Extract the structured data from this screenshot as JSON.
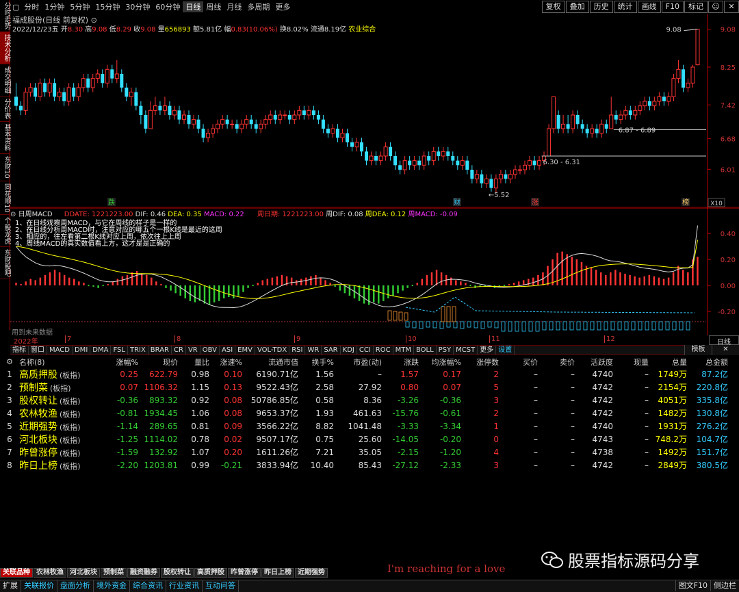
{
  "left_tabs": [
    "分时走势",
    "技术分析",
    "成交明细",
    "分价表",
    "基本资料",
    "东财10",
    "同花顺10",
    "个股龙虎",
    "东财股吧"
  ],
  "left_tab_active": 1,
  "periods": [
    "分时",
    "1分钟",
    "5分钟",
    "15分钟",
    "30分钟",
    "60分钟",
    "日线",
    "周线",
    "月线",
    "多周期",
    "更多"
  ],
  "period_active": 6,
  "right_buttons": [
    "复权",
    "叠加",
    "历史",
    "统计",
    "画线",
    "F10",
    "标记"
  ],
  "stock_title": "福成股份(日线 前复权)",
  "quote": {
    "date": "2022/12/23五",
    "open_label": "开",
    "open": "8.30",
    "high_label": "高",
    "high": "9.08",
    "low_label": "低",
    "low": "8.29",
    "close_label": "收",
    "close": "9.08",
    "vol_label": "量",
    "vol": "656893",
    "amount": "额5.81亿",
    "chg_label": "幅",
    "chg": "0.83(10.06%)",
    "turnover": "换8.02%",
    "float": "流通8.19亿",
    "sector": "农业综合"
  },
  "chart_data": [
    {
      "type": "candlestick",
      "title": "福成股份(日线 前复权)",
      "y_ticks": [
        "9.08",
        "8.25",
        "7.42",
        "6.68",
        "6.01"
      ],
      "ylim": [
        5.4,
        9.3
      ],
      "labels": {
        "hi": "9.08",
        "lo": "5.52",
        "zone1": "6.87 - 6.89",
        "zone2": "6.30 - 6.31"
      },
      "signals": [
        "跌",
        "财",
        "涨",
        "榜"
      ],
      "x10": "X10",
      "date_ticks": [
        "2022年",
        "7",
        "8",
        "9",
        "10",
        "11",
        "12"
      ],
      "ohlc": [
        [
          7.6,
          7.4,
          7.9,
          7.3
        ],
        [
          7.4,
          7.3,
          7.5,
          7.2
        ],
        [
          7.3,
          7.7,
          7.8,
          7.2
        ],
        [
          7.7,
          7.8,
          7.9,
          7.6
        ],
        [
          7.8,
          7.6,
          7.9,
          7.5
        ],
        [
          7.6,
          7.9,
          8.0,
          7.5
        ],
        [
          7.9,
          7.7,
          8.0,
          7.6
        ],
        [
          7.7,
          7.9,
          8.0,
          7.6
        ],
        [
          7.9,
          7.6,
          8.0,
          7.5
        ],
        [
          7.6,
          7.7,
          7.8,
          7.5
        ],
        [
          7.7,
          7.5,
          7.8,
          7.4
        ],
        [
          7.5,
          7.8,
          7.9,
          7.4
        ],
        [
          7.8,
          7.6,
          7.9,
          7.5
        ],
        [
          7.6,
          7.8,
          7.9,
          7.5
        ],
        [
          7.8,
          8.0,
          8.1,
          7.7
        ],
        [
          8.0,
          7.8,
          8.1,
          7.7
        ],
        [
          7.8,
          8.0,
          8.1,
          7.7
        ],
        [
          8.0,
          8.1,
          8.2,
          7.9
        ],
        [
          8.1,
          7.9,
          8.2,
          7.8
        ],
        [
          7.9,
          8.2,
          8.3,
          7.8
        ],
        [
          8.2,
          8.0,
          8.3,
          7.9
        ],
        [
          8.0,
          8.1,
          8.4,
          7.9
        ],
        [
          8.1,
          7.8,
          8.2,
          7.7
        ],
        [
          7.8,
          7.6,
          7.9,
          7.5
        ],
        [
          7.6,
          7.7,
          7.8,
          7.4
        ],
        [
          7.7,
          7.4,
          7.8,
          7.3
        ],
        [
          7.4,
          7.2,
          7.5,
          7.0
        ],
        [
          7.2,
          6.9,
          7.3,
          6.8
        ],
        [
          6.9,
          7.3,
          7.5,
          6.9
        ],
        [
          7.3,
          7.4,
          7.6,
          7.2
        ],
        [
          7.4,
          7.3,
          7.5,
          7.2
        ],
        [
          7.3,
          7.4,
          7.6,
          7.2
        ],
        [
          7.4,
          7.2,
          7.5,
          7.1
        ],
        [
          7.2,
          7.3,
          7.4,
          7.1
        ],
        [
          7.3,
          7.1,
          7.4,
          7.0
        ],
        [
          7.1,
          7.2,
          7.3,
          7.0
        ],
        [
          7.2,
          7.0,
          7.3,
          6.9
        ],
        [
          7.0,
          7.1,
          7.2,
          6.9
        ],
        [
          7.1,
          6.9,
          7.2,
          6.8
        ],
        [
          6.9,
          6.7,
          7.0,
          6.6
        ],
        [
          6.7,
          6.8,
          6.9,
          6.6
        ],
        [
          6.8,
          6.9,
          7.0,
          6.7
        ],
        [
          6.9,
          7.0,
          7.1,
          6.8
        ],
        [
          7.0,
          7.1,
          7.2,
          6.9
        ],
        [
          7.1,
          7.0,
          7.2,
          6.9
        ],
        [
          7.0,
          7.0,
          7.1,
          6.9
        ],
        [
          7.0,
          6.9,
          7.1,
          6.8
        ],
        [
          6.9,
          7.0,
          7.1,
          6.8
        ],
        [
          7.0,
          7.1,
          7.2,
          6.9
        ],
        [
          7.1,
          7.0,
          7.2,
          6.9
        ],
        [
          7.0,
          6.9,
          7.1,
          6.8
        ],
        [
          6.9,
          7.0,
          7.1,
          6.8
        ],
        [
          7.0,
          7.1,
          7.2,
          6.9
        ],
        [
          7.1,
          7.2,
          7.3,
          7.0
        ],
        [
          7.2,
          7.1,
          7.3,
          7.0
        ],
        [
          7.1,
          7.2,
          7.3,
          7.0
        ],
        [
          7.2,
          7.2,
          7.3,
          7.1
        ],
        [
          7.2,
          7.1,
          7.3,
          7.0
        ],
        [
          7.1,
          7.2,
          7.3,
          7.0
        ],
        [
          7.2,
          7.3,
          7.4,
          7.1
        ],
        [
          7.3,
          7.2,
          7.4,
          7.1
        ],
        [
          7.2,
          7.3,
          7.4,
          7.1
        ],
        [
          7.3,
          7.2,
          7.4,
          7.1
        ],
        [
          7.2,
          7.1,
          7.3,
          7.0
        ],
        [
          7.1,
          6.9,
          7.2,
          6.8
        ],
        [
          6.9,
          6.8,
          7.0,
          6.7
        ],
        [
          6.8,
          6.9,
          7.0,
          6.7
        ],
        [
          6.9,
          6.7,
          7.0,
          6.6
        ],
        [
          6.7,
          6.8,
          6.9,
          6.6
        ],
        [
          6.8,
          6.6,
          6.9,
          6.5
        ],
        [
          6.6,
          6.5,
          6.7,
          6.4
        ],
        [
          6.5,
          6.6,
          6.7,
          6.4
        ],
        [
          6.6,
          6.4,
          6.7,
          6.3
        ],
        [
          6.4,
          6.2,
          6.5,
          6.1
        ],
        [
          6.2,
          6.3,
          6.4,
          6.1
        ],
        [
          6.3,
          6.2,
          6.4,
          6.1
        ],
        [
          6.2,
          6.3,
          6.4,
          6.1
        ],
        [
          6.3,
          6.5,
          6.6,
          6.2
        ],
        [
          6.5,
          6.3,
          6.6,
          6.2
        ],
        [
          6.3,
          6.1,
          6.4,
          6.0
        ],
        [
          6.1,
          6.0,
          6.2,
          5.9
        ],
        [
          6.0,
          6.2,
          6.3,
          5.9
        ],
        [
          6.2,
          6.1,
          6.3,
          6.0
        ],
        [
          6.1,
          6.2,
          6.3,
          6.0
        ],
        [
          6.2,
          6.1,
          6.3,
          6.0
        ],
        [
          6.1,
          6.3,
          6.4,
          6.0
        ],
        [
          6.3,
          6.2,
          6.4,
          6.1
        ],
        [
          6.2,
          6.4,
          6.5,
          6.1
        ],
        [
          6.4,
          6.3,
          6.5,
          6.2
        ],
        [
          6.3,
          6.4,
          6.5,
          6.2
        ],
        [
          6.4,
          6.3,
          6.5,
          6.2
        ],
        [
          6.3,
          6.2,
          6.4,
          6.1
        ],
        [
          6.2,
          6.1,
          6.3,
          6.0
        ],
        [
          6.1,
          6.2,
          6.3,
          6.0
        ],
        [
          6.2,
          6.0,
          6.3,
          5.9
        ],
        [
          6.0,
          5.8,
          6.1,
          5.7
        ],
        [
          5.8,
          5.9,
          6.0,
          5.7
        ],
        [
          5.9,
          5.7,
          6.0,
          5.6
        ],
        [
          5.7,
          5.8,
          5.9,
          5.6
        ],
        [
          5.8,
          5.6,
          5.9,
          5.52
        ],
        [
          5.6,
          5.8,
          5.9,
          5.5
        ],
        [
          5.8,
          5.9,
          6.0,
          5.7
        ],
        [
          5.9,
          5.8,
          6.0,
          5.7
        ],
        [
          5.8,
          5.9,
          6.0,
          5.7
        ],
        [
          5.9,
          6.0,
          6.1,
          5.8
        ],
        [
          6.0,
          6.0,
          6.1,
          5.9
        ],
        [
          6.0,
          6.1,
          6.2,
          5.9
        ],
        [
          6.1,
          6.2,
          6.3,
          6.0
        ],
        [
          6.2,
          6.1,
          6.3,
          6.0
        ],
        [
          6.1,
          6.2,
          6.3,
          6.0
        ],
        [
          6.2,
          6.3,
          6.4,
          6.1
        ],
        [
          6.3,
          6.9,
          7.0,
          6.3
        ],
        [
          6.9,
          7.6,
          7.6,
          6.8
        ],
        [
          7.2,
          6.9,
          7.3,
          6.8
        ],
        [
          6.9,
          7.0,
          7.2,
          6.8
        ],
        [
          7.0,
          6.9,
          7.2,
          6.8
        ],
        [
          6.9,
          7.2,
          7.3,
          6.8
        ],
        [
          7.2,
          7.0,
          7.3,
          6.9
        ],
        [
          7.0,
          6.9,
          7.1,
          6.8
        ],
        [
          6.9,
          6.8,
          7.0,
          6.7
        ],
        [
          6.8,
          6.9,
          7.0,
          6.7
        ],
        [
          6.9,
          6.8,
          7.0,
          6.7
        ],
        [
          6.8,
          7.0,
          7.1,
          6.7
        ],
        [
          7.0,
          6.9,
          7.1,
          6.8
        ],
        [
          6.9,
          7.2,
          7.6,
          6.9
        ],
        [
          7.2,
          7.1,
          7.3,
          7.0
        ],
        [
          7.1,
          7.2,
          7.3,
          7.0
        ],
        [
          7.2,
          7.3,
          7.4,
          7.1
        ],
        [
          7.3,
          7.2,
          7.4,
          7.1
        ],
        [
          7.2,
          7.3,
          7.4,
          7.1
        ],
        [
          7.3,
          7.4,
          7.5,
          7.2
        ],
        [
          7.4,
          7.5,
          7.6,
          7.3
        ],
        [
          7.5,
          7.4,
          7.6,
          7.3
        ],
        [
          7.4,
          7.5,
          7.6,
          7.3
        ],
        [
          7.5,
          7.6,
          7.7,
          7.4
        ],
        [
          7.6,
          7.5,
          7.7,
          7.4
        ],
        [
          7.5,
          7.6,
          7.7,
          7.4
        ],
        [
          7.6,
          8.0,
          8.1,
          7.5
        ],
        [
          8.0,
          8.2,
          8.4,
          7.9
        ],
        [
          8.2,
          7.8,
          8.3,
          7.7
        ],
        [
          7.8,
          7.9,
          8.0,
          7.7
        ],
        [
          7.9,
          8.25,
          8.3,
          7.8
        ],
        [
          8.3,
          9.08,
          9.08,
          8.29
        ]
      ],
      "macd_hist": [
        0.02,
        0.01,
        0.03,
        0.05,
        0.04,
        0.06,
        0.08,
        0.1,
        0.12,
        0.1,
        0.08,
        0.06,
        0.05,
        0.03,
        0.02,
        0.0,
        -0.01,
        -0.02,
        0.0,
        0.01,
        0.03,
        0.05,
        0.07,
        0.08,
        0.1,
        0.11,
        0.09,
        0.08,
        0.06,
        0.03,
        0.01,
        -0.02,
        -0.04,
        -0.06,
        -0.08,
        -0.1,
        -0.12,
        -0.13,
        -0.12,
        -0.14,
        -0.15,
        -0.13,
        -0.12,
        -0.1,
        -0.09,
        -0.1,
        -0.08,
        -0.05,
        -0.02,
        0.0,
        0.02,
        0.04,
        0.05,
        0.06,
        0.07,
        0.08,
        0.07,
        0.06,
        0.04,
        0.05,
        0.06,
        0.07,
        0.08,
        0.06,
        0.04,
        0.02,
        -0.01,
        -0.04,
        -0.06,
        -0.08,
        -0.1,
        -0.12,
        -0.14,
        -0.15,
        -0.13,
        -0.14,
        -0.12,
        -0.1,
        -0.08,
        -0.06,
        -0.04,
        -0.02,
        0.0,
        0.02,
        0.05,
        0.08,
        0.1,
        0.12,
        0.1,
        0.08,
        0.06,
        0.04,
        0.03,
        0.02,
        0.0,
        -0.02,
        -0.01,
        -0.01,
        -0.01,
        -0.02,
        -0.01,
        0.0,
        0.01,
        0.02,
        0.03,
        0.04,
        0.05,
        0.06,
        0.08,
        0.1,
        0.15,
        0.2,
        0.25,
        0.26,
        0.24,
        0.22,
        0.2,
        0.18,
        0.15,
        0.14,
        0.12,
        0.1,
        0.08,
        0.1,
        0.12,
        0.1,
        0.09,
        0.08,
        0.07,
        0.06,
        0.07,
        0.08,
        0.07,
        0.06,
        0.05,
        0.06,
        0.1,
        0.15,
        0.12,
        0.1,
        0.2,
        0.22
      ],
      "macd_y_ticks": [
        "0.40",
        "0.20",
        "0.00",
        "-0.20"
      ]
    }
  ],
  "indicator": {
    "name": "日周MACD",
    "ddate": "DDATE: 1221223.00",
    "dif": "DIF: 0.46",
    "dea": "DEA: 0.35",
    "macd": "MACD: 0.22",
    "week_date": "周日期: 1221223.00",
    "wdif": "周DIF: 0.08",
    "wdea": "周DEA: 0.12",
    "wmacd": "周MACD: -0.09"
  },
  "notes": [
    "1、在日线观察周MACD，与它在周线的样子是一样的",
    "2、在日线分析周MACD时，注意对应的哪五个一根K线是最近的这周",
    "3、相应的，往左看第二根K线对应上周，依次往上上周",
    "4、周线MACD的真实数值看上方，这才是是正确的"
  ],
  "future_text": "用到未来数据",
  "day_label": "日线",
  "ind_tabs": [
    "指标",
    "窗口",
    "MACD",
    "DMI",
    "DMA",
    "FSL",
    "TRIX",
    "BRAR",
    "CR",
    "VR",
    "OBV",
    "ASI",
    "EMV",
    "VOL-TDX",
    "RSI",
    "WR",
    "SAR",
    "KDJ",
    "CCI",
    "ROC",
    "MTM",
    "BOLL",
    "PSY",
    "MCST",
    "更多",
    "设置"
  ],
  "tpl_buttons": [
    "模板",
    "✕"
  ],
  "table": {
    "headers": [
      "",
      "名称(8)",
      "涨幅%",
      "现价",
      "量比",
      "涨速%",
      "流通市值",
      "换手%",
      "市盈(动)",
      "涨跌",
      "均涨幅%",
      "涨停数",
      "买价",
      "卖价",
      "活跃度",
      "现量",
      "总量",
      "总金额"
    ],
    "rows": [
      [
        "1",
        "高质押股",
        "0.25",
        "622.79",
        "0.98",
        "0.10",
        "6190.71亿",
        "1.56",
        "–",
        "1.57",
        "0.17",
        "2",
        "–",
        "–",
        "4740",
        "–",
        "1749万",
        "87.2亿"
      ],
      [
        "2",
        "预制菜",
        "0.07",
        "1106.32",
        "1.15",
        "0.13",
        "9522.43亿",
        "2.58",
        "27.92",
        "0.80",
        "0.07",
        "5",
        "–",
        "–",
        "4742",
        "–",
        "2154万",
        "220.8亿"
      ],
      [
        "3",
        "股权转让",
        "-0.36",
        "893.32",
        "0.92",
        "0.08",
        "50786.85亿",
        "0.58",
        "8.36",
        "-3.26",
        "-0.36",
        "3",
        "–",
        "–",
        "4742",
        "–",
        "4051万",
        "335.8亿"
      ],
      [
        "4",
        "农林牧渔",
        "-0.81",
        "1934.45",
        "1.06",
        "0.08",
        "9653.37亿",
        "1.93",
        "461.63",
        "-15.76",
        "-0.61",
        "2",
        "–",
        "–",
        "4742",
        "–",
        "1482万",
        "130.8亿"
      ],
      [
        "5",
        "近期强势",
        "-1.14",
        "289.65",
        "0.81",
        "0.09",
        "3566.22亿",
        "8.82",
        "1041.48",
        "-3.33",
        "-3.34",
        "1",
        "–",
        "–",
        "4740",
        "–",
        "1931万",
        "276.2亿"
      ],
      [
        "6",
        "河北板块",
        "-1.25",
        "1114.02",
        "0.78",
        "0.02",
        "9507.17亿",
        "0.75",
        "25.60",
        "-14.05",
        "-0.20",
        "0",
        "–",
        "–",
        "4743",
        "–",
        "748.2万",
        "104.7亿"
      ],
      [
        "7",
        "昨曾涨停",
        "-1.59",
        "132.92",
        "1.07",
        "0.20",
        "1611.26亿",
        "7.21",
        "35.05",
        "-2.15",
        "-1.20",
        "4",
        "–",
        "–",
        "4738",
        "–",
        "1492万",
        "151.7亿"
      ],
      [
        "8",
        "昨日上榜",
        "-2.20",
        "1203.81",
        "0.99",
        "-0.21",
        "3833.94亿",
        "10.40",
        "85.43",
        "-27.12",
        "-2.33",
        "3",
        "–",
        "–",
        "4742",
        "–",
        "2849万",
        "380.5亿"
      ]
    ],
    "tag": "(板指)"
  },
  "bottom_tabs": [
    "关联品种",
    "农林牧渔",
    "河北板块",
    "预制菜",
    "融资融券",
    "股权转让",
    "高质押股",
    "昨曾涨停",
    "昨日上榜",
    "近期强势"
  ],
  "love_text": "I'm reaching for a love",
  "watermark": "股票指标源码分享",
  "status_tabs": [
    "扩展",
    "关联报价",
    "盘面分析",
    "境外资金",
    "综合资讯",
    "行业资讯",
    "互动问答"
  ],
  "status_right": [
    "图文F10",
    "侧边栏"
  ],
  "colors": {
    "up": "#ff3333",
    "down": "#33e0ff",
    "green": "#33cc33",
    "yellow": "#ffff00",
    "bg": "#000000"
  }
}
